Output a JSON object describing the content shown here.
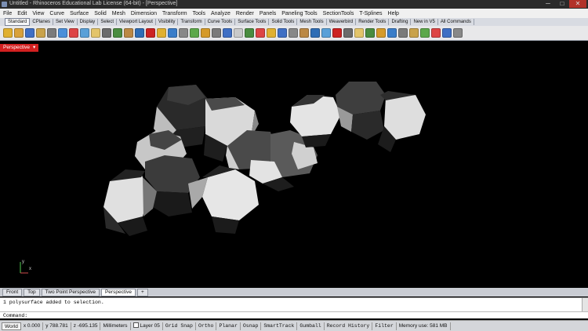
{
  "titlebar": {
    "title": "Untitled - Rhinoceros Educational Lab License (64-bit) - [Perspective]",
    "min": "─",
    "max": "□",
    "close": "✕"
  },
  "menu": [
    "File",
    "Edit",
    "View",
    "Curve",
    "Surface",
    "Solid",
    "Mesh",
    "Dimension",
    "Transform",
    "Tools",
    "Analyze",
    "Render",
    "Panels",
    "Paneling Tools",
    "SectionTools",
    "T-Splines",
    "Help"
  ],
  "toolbar_tabs": [
    "Standard",
    "CPlanes",
    "Set View",
    "Display",
    "Select",
    "Viewport Layout",
    "Visibility",
    "Transform",
    "Curve Tools",
    "Surface Tools",
    "Solid Tools",
    "Mesh Tools",
    "Weaverbird",
    "Render Tools",
    "Drafting",
    "New in V5",
    "All Commands"
  ],
  "toolbar_icon_colors": [
    "#e0b030",
    "#d9a13a",
    "#3f6fc4",
    "#c9a24a",
    "#7b7b7b",
    "#4b8fd9",
    "#d44",
    "#5aa0d8",
    "#e3c46a",
    "#6b6b6b",
    "#4a8c3f",
    "#b84",
    "#2f6db5",
    "#c22",
    "#e0b030",
    "#3a7dc9",
    "#888",
    "#5ca84a",
    "#d59a2a",
    "#7a7a7a",
    "#3f6fc4",
    "#c9c9c9",
    "#4a8c3f",
    "#d44",
    "#e0b030",
    "#3f6fc4",
    "#888",
    "#b84",
    "#2f6db5",
    "#5aa0d8",
    "#c22",
    "#6b6b6b",
    "#e3c46a",
    "#4a8c3f",
    "#d59a2a",
    "#3a7dc9",
    "#7b7b7b",
    "#c9a24a",
    "#5ca84a",
    "#d44",
    "#3f6fc4",
    "#888"
  ],
  "viewport": {
    "active_tab": "Perspective",
    "dropdown_icon": "▾",
    "axis_labels": {
      "x": "x",
      "y": "y"
    }
  },
  "viewport_tabs": [
    "Front",
    "Top",
    "Two Point Perspective",
    "Perspective",
    "+"
  ],
  "active_viewport_tab": "Perspective",
  "command": {
    "history": "1 polysurface added to selection.",
    "prompt": "Command:"
  },
  "status": {
    "world": "World",
    "x": "x 0.000",
    "y": "y 788.781",
    "z": "z -695.135",
    "units": "Millimeters",
    "layer": "Layer 05",
    "panes": [
      "Grid Snap",
      "Ortho",
      "Planar",
      "Osnap",
      "SmartTrack",
      "Gumball",
      "Record History",
      "Filter"
    ],
    "memory": "Memory use: 581 MB"
  }
}
